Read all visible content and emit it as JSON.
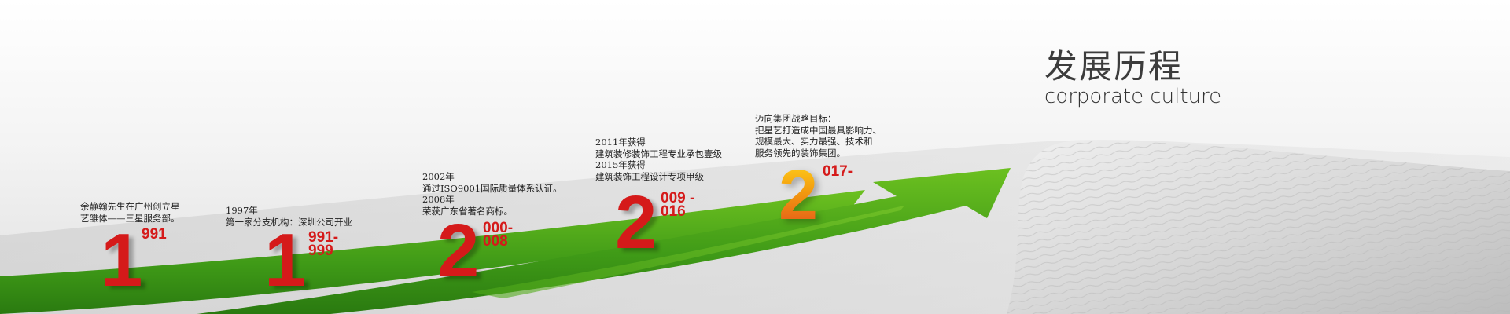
{
  "heading": {
    "title_cn": "发展历程",
    "title_en": "corporate culture"
  },
  "milestones": [
    {
      "big_digit": "1",
      "year_rest": [
        "991"
      ],
      "lines": [
        "余静翰先生在广州创立星",
        "艺雏体——三星服务部。"
      ]
    },
    {
      "big_digit": "1",
      "year_rest": [
        "991-",
        "999"
      ],
      "lines": [
        "1997年",
        "第一家分支机构：深圳公司开业"
      ]
    },
    {
      "big_digit": "2",
      "year_rest": [
        "000-",
        "008"
      ],
      "lines": [
        "2002年",
        "通过ISO9001国际质量体系认证。",
        "2008年",
        "荣获广东省著名商标。"
      ]
    },
    {
      "big_digit": "2",
      "year_rest": [
        "009 -",
        "016"
      ],
      "lines": [
        "2011年获得",
        "建筑装修装饰工程专业承包壹级",
        "2015年获得",
        "建筑装饰工程设计专项甲级"
      ]
    },
    {
      "big_digit": "2",
      "year_rest": [
        "017-"
      ],
      "lines": [
        "迈向集团战略目标：",
        "把星艺打造成中国最具影响力、",
        "规模最大、实力最强、技术和",
        "服务领先的装饰集团。"
      ]
    }
  ],
  "colors": {
    "year_red": "#d51a1a",
    "arrow_green": "#3f9a17",
    "latest_year_gradient": [
      "#ffd21a",
      "#e4541a"
    ]
  }
}
